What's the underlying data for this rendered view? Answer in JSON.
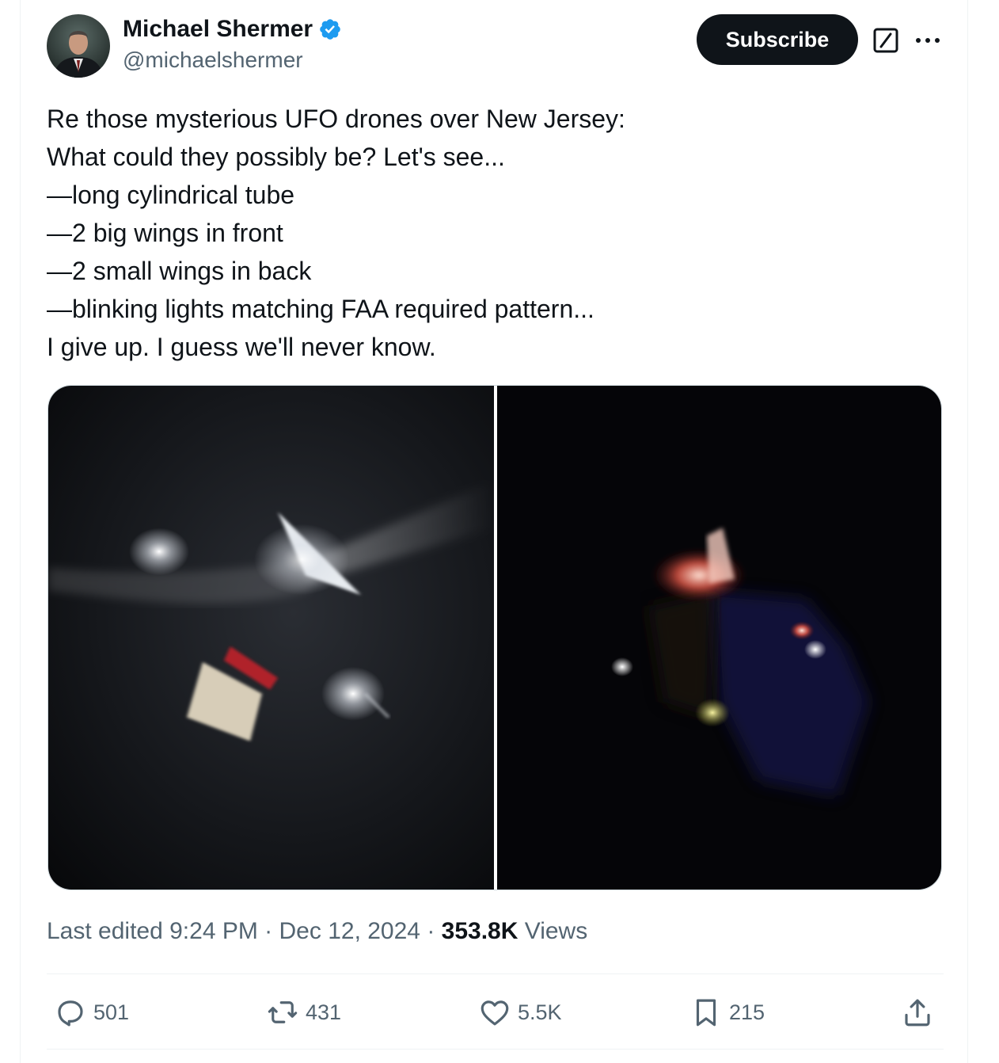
{
  "author": {
    "name": "Michael Shermer",
    "handle": "@michaelshermer",
    "verified": true
  },
  "header": {
    "subscribe_label": "Subscribe"
  },
  "tweet": {
    "lines": [
      "Re those mysterious UFO drones over New Jersey:",
      "What could they possibly be? Let's see...",
      "—long cylindrical tube",
      "—2 big wings in front",
      "—2 small wings in back",
      "—blinking lights matching FAA required pattern...",
      "I give up. I guess we'll never know."
    ]
  },
  "meta": {
    "edited": "Last edited 9:24 PM",
    "sep1": " · ",
    "date": "Dec 12, 2024",
    "sep2": " · ",
    "views_count": "353.8K",
    "views_label": " Views"
  },
  "actions": {
    "replies": "501",
    "reposts": "431",
    "likes": "5.5K",
    "bookmarks": "215"
  },
  "colors": {
    "text": "#0f1419",
    "secondary": "#536471",
    "verified": "#1d9bf0",
    "border": "#eff3f4"
  },
  "icons": [
    "verified-badge-icon",
    "grok-icon",
    "more-icon",
    "reply-icon",
    "repost-icon",
    "like-icon",
    "bookmark-icon",
    "share-icon"
  ]
}
